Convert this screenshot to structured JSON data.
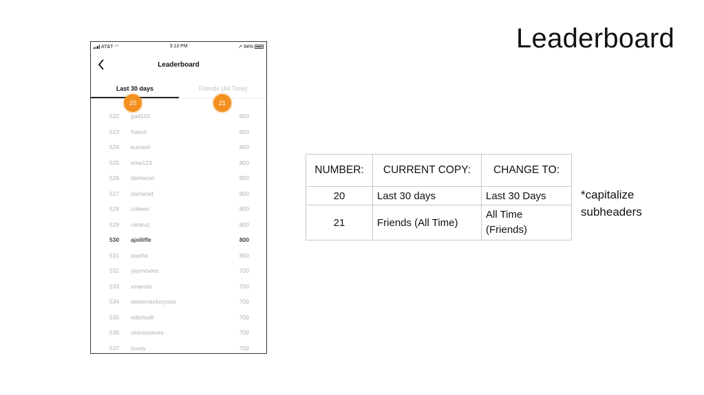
{
  "slide": {
    "title": "Leaderboard",
    "note_line1": "*capitalize",
    "note_line2": "subheaders"
  },
  "phone": {
    "status_bar": {
      "carrier": "AT&T",
      "time": "3:13 PM",
      "battery_pct": "94%"
    },
    "nav": {
      "back_icon": "chevron-left-icon",
      "title": "Leaderboard"
    },
    "tabs": [
      {
        "label": "Last 30 days",
        "active": true
      },
      {
        "label": "Friends (All Time)",
        "active": false
      }
    ],
    "badges": [
      "20",
      "21"
    ],
    "badge_color": "#f39020",
    "rows": [
      {
        "rank": "522",
        "user": "gad101",
        "points": "800"
      },
      {
        "rank": "523",
        "user": "francii",
        "points": "800"
      },
      {
        "rank": "524",
        "user": "eurosol",
        "points": "800"
      },
      {
        "rank": "525",
        "user": "eme123",
        "points": "800"
      },
      {
        "rank": "526",
        "user": "demacon",
        "points": "800"
      },
      {
        "rank": "527",
        "user": "dariisrad",
        "points": "800"
      },
      {
        "rank": "528",
        "user": "colleen",
        "points": "800"
      },
      {
        "rank": "529",
        "user": "cataruz",
        "points": "800"
      },
      {
        "rank": "530",
        "user": "ajolliffe",
        "points": "800",
        "current_user": true
      },
      {
        "rank": "531",
        "user": "aastha",
        "points": "800"
      },
      {
        "rank": "532",
        "user": "yaymovies",
        "points": "700"
      },
      {
        "rank": "533",
        "user": "xmaroto",
        "points": "700"
      },
      {
        "rank": "534",
        "user": "winterneckcrystal",
        "points": "700"
      },
      {
        "rank": "535",
        "user": "willohwill",
        "points": "700"
      },
      {
        "rank": "536",
        "user": "viniciusalves",
        "points": "700"
      },
      {
        "rank": "537",
        "user": "txxely",
        "points": "700"
      }
    ]
  },
  "copy_table": {
    "headers": [
      "NUMBER:",
      "CURRENT COPY:",
      "CHANGE TO:"
    ],
    "rows": [
      {
        "number": "20",
        "current": "Last 30 days",
        "change_line1": "Last 30 Days",
        "change_line2": ""
      },
      {
        "number": "21",
        "current": "Friends (All Time)",
        "change_line1": "All Time",
        "change_line2": "(Friends)"
      }
    ]
  }
}
